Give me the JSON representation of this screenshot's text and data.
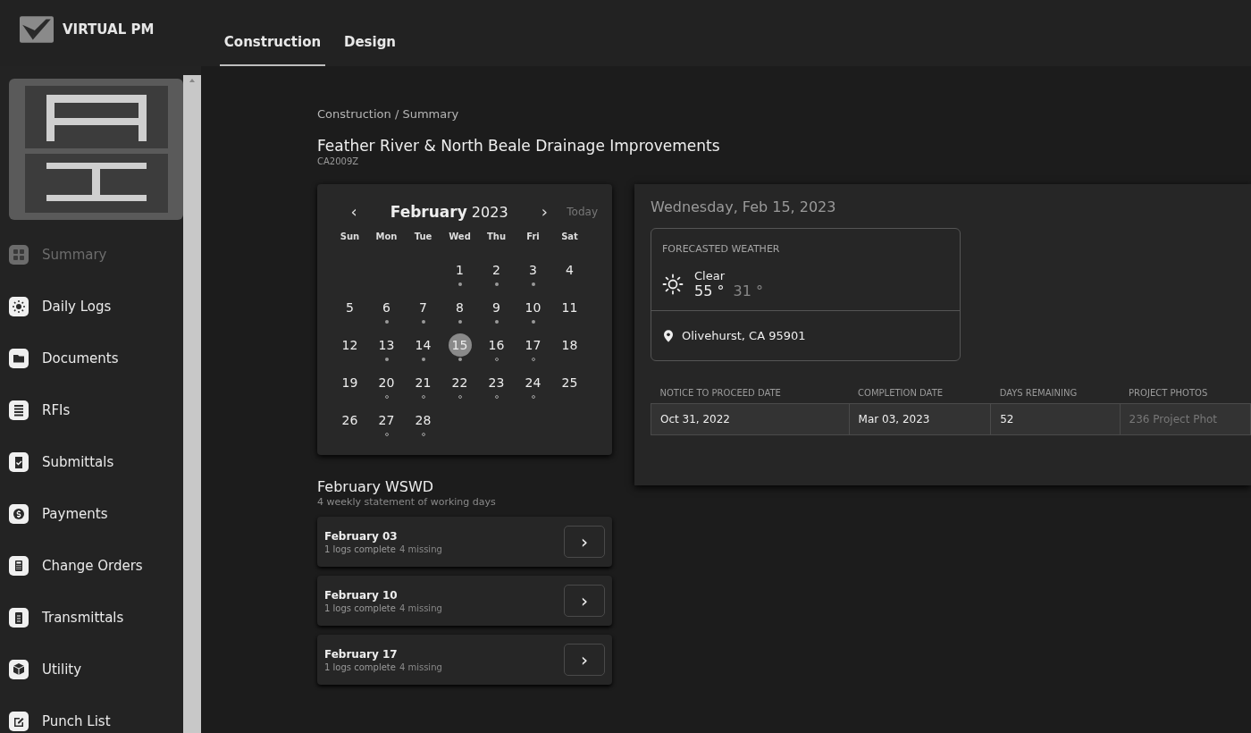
{
  "app": {
    "name": "VIRTUAL PM"
  },
  "tabs": [
    {
      "label": "Construction",
      "selected": true
    },
    {
      "label": "Design",
      "selected": false
    }
  ],
  "sidebar": {
    "items": [
      {
        "label": "Summary",
        "selected": true
      },
      {
        "label": "Daily Logs",
        "selected": false
      },
      {
        "label": "Documents",
        "selected": false
      },
      {
        "label": "RFIs",
        "selected": false
      },
      {
        "label": "Submittals",
        "selected": false
      },
      {
        "label": "Payments",
        "selected": false
      },
      {
        "label": "Change Orders",
        "selected": false
      },
      {
        "label": "Transmittals",
        "selected": false
      },
      {
        "label": "Utility",
        "selected": false
      },
      {
        "label": "Punch List",
        "selected": false
      }
    ]
  },
  "breadcrumb": "Construction / Summary",
  "project": {
    "title": "Feather River & North Beale Drainage Improvements",
    "code": "CA2009Z"
  },
  "calendar": {
    "prev": "‹",
    "month": "February",
    "year": "2023",
    "next": "›",
    "today": "Today",
    "weekdays": [
      "Sun",
      "Mon",
      "Tue",
      "Wed",
      "Thu",
      "Fri",
      "Sat"
    ],
    "weeks": [
      {
        "days": [
          {
            "kind": "blank"
          },
          {
            "kind": "blank"
          },
          {
            "kind": "blank"
          },
          {
            "kind": "logged",
            "day": "1",
            "selected": false
          },
          {
            "kind": "logged",
            "day": "2",
            "selected": false
          },
          {
            "kind": "logged",
            "day": "3",
            "selected": false
          },
          {
            "kind": "plain",
            "day": "4",
            "selected": false
          }
        ]
      },
      {
        "days": [
          {
            "kind": "plain",
            "day": "5",
            "selected": false
          },
          {
            "kind": "logged",
            "day": "6",
            "selected": false
          },
          {
            "kind": "logged",
            "day": "7",
            "selected": false
          },
          {
            "kind": "logged",
            "day": "8",
            "selected": false
          },
          {
            "kind": "logged",
            "day": "9",
            "selected": false
          },
          {
            "kind": "logged",
            "day": "10",
            "selected": false
          },
          {
            "kind": "plain",
            "day": "11",
            "selected": false
          }
        ]
      },
      {
        "days": [
          {
            "kind": "plain",
            "day": "12",
            "selected": false
          },
          {
            "kind": "logged",
            "day": "13",
            "selected": false
          },
          {
            "kind": "logged",
            "day": "14",
            "selected": false
          },
          {
            "kind": "logged",
            "day": "15",
            "selected": true
          },
          {
            "kind": "pending",
            "day": "16",
            "selected": false
          },
          {
            "kind": "pending",
            "day": "17",
            "selected": false
          },
          {
            "kind": "plain",
            "day": "18",
            "selected": false
          }
        ]
      },
      {
        "days": [
          {
            "kind": "plain",
            "day": "19",
            "selected": false
          },
          {
            "kind": "pending",
            "day": "20",
            "selected": false
          },
          {
            "kind": "pending",
            "day": "21",
            "selected": false
          },
          {
            "kind": "pending",
            "day": "22",
            "selected": false
          },
          {
            "kind": "pending",
            "day": "23",
            "selected": false
          },
          {
            "kind": "pending",
            "day": "24",
            "selected": false
          },
          {
            "kind": "plain",
            "day": "25",
            "selected": false
          }
        ]
      },
      {
        "days": [
          {
            "kind": "plain",
            "day": "26",
            "selected": false
          },
          {
            "kind": "pending",
            "day": "27",
            "selected": false
          },
          {
            "kind": "pending",
            "day": "28",
            "selected": false
          }
        ]
      }
    ]
  },
  "wswd": {
    "title": "February WSWD",
    "subtitle": "4 weekly statement of working days",
    "weeks": [
      {
        "title": "February 03",
        "complete": "1 logs complete",
        "missing": "4 missing",
        "button": "›"
      },
      {
        "title": "February 10",
        "complete": "1 logs complete",
        "missing": "4 missing",
        "button": "›"
      },
      {
        "title": "February 17",
        "complete": "1 logs complete",
        "missing": "4 missing",
        "button": "›"
      }
    ]
  },
  "day_panel": {
    "date": "Wednesday, Feb 15, 2023",
    "weather": {
      "heading": "FORECASTED WEATHER",
      "condition": "Clear",
      "high": "55 °",
      "low": "31 °",
      "location": "Olivehurst, CA 95901"
    },
    "table": {
      "columns": [
        "NOTICE TO PROCEED DATE",
        "COMPLETION DATE",
        "DAYS REMAINING",
        "PROJECT PHOTOS"
      ],
      "rows": [
        [
          {
            "text": "Oct 31, 2022",
            "muted": false
          },
          {
            "text": "Mar 03, 2023",
            "muted": false
          },
          {
            "text": "52",
            "muted": false
          },
          {
            "text": "236 Project Phot",
            "muted": true
          }
        ]
      ]
    }
  }
}
